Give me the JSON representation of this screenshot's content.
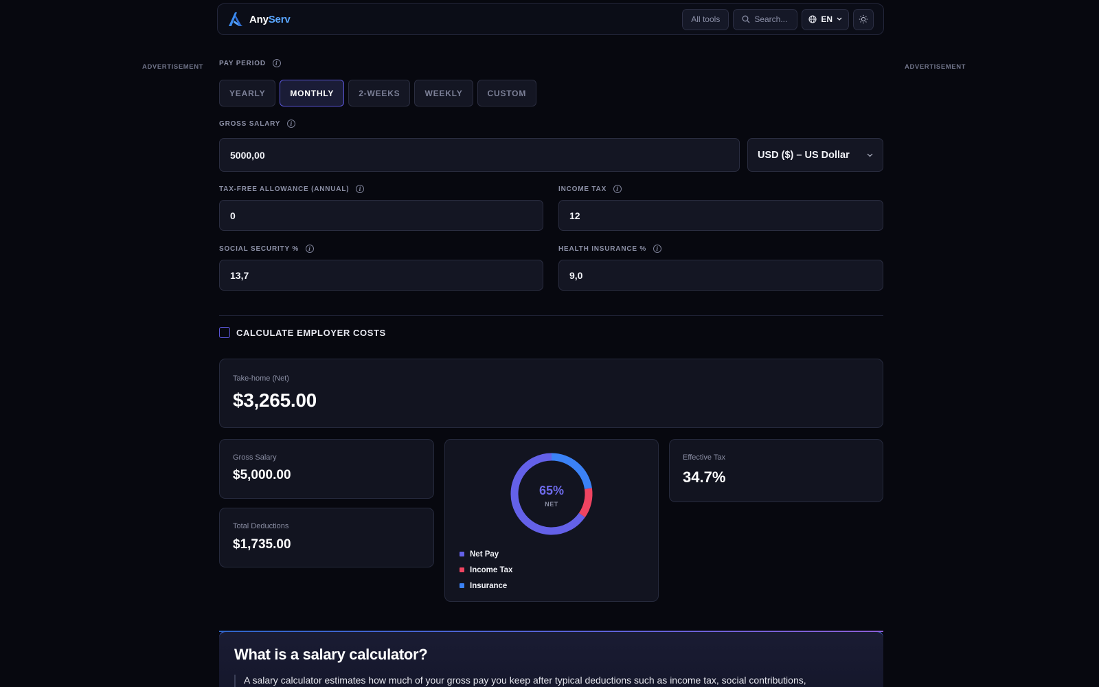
{
  "header": {
    "brand_any": "Any",
    "brand_serv": "Serv",
    "all_tools": "All tools",
    "search_placeholder": "Search...",
    "language": "EN"
  },
  "ads": {
    "left": "ADVERTISEMENT",
    "right": "ADVERTISEMENT"
  },
  "form": {
    "pay_period_label": "PAY PERIOD",
    "pay_periods": [
      "YEARLY",
      "MONTHLY",
      "2-WEEKS",
      "WEEKLY",
      "CUSTOM"
    ],
    "active_period": "MONTHLY",
    "gross_salary_label": "GROSS SALARY",
    "gross_salary_value": "5000,00",
    "currency": "USD ($) – US Dollar",
    "tax_free_label": "TAX-FREE ALLOWANCE (ANNUAL)",
    "tax_free_value": "0",
    "income_tax_label": "INCOME TAX",
    "income_tax_value": "12",
    "social_security_label": "SOCIAL SECURITY %",
    "social_security_value": "13,7",
    "health_insurance_label": "HEALTH INSURANCE %",
    "health_insurance_value": "9,0",
    "employer_costs_label": "CALCULATE EMPLOYER COSTS"
  },
  "results": {
    "net_label": "Take-home (Net)",
    "net_value": "$3,265.00",
    "gross_label": "Gross Salary",
    "gross_value": "$5,000.00",
    "deductions_label": "Total Deductions",
    "deductions_value": "$1,735.00",
    "effective_tax_label": "Effective Tax",
    "effective_tax_value": "34.7%",
    "donut_percent": "65%",
    "donut_sub": "NET",
    "legend": [
      {
        "name": "Net Pay",
        "color": "#6461e8"
      },
      {
        "name": "Income Tax",
        "color": "#ef4461"
      },
      {
        "name": "Insurance",
        "color": "#3b82f6"
      }
    ],
    "breakdown": {
      "net": 3265,
      "income_tax": 600,
      "insurance": 1135
    }
  },
  "info": {
    "title": "What is a salary calculator?",
    "text": "A salary calculator estimates how much of your gross pay you keep after typical deductions such as income tax, social contributions,"
  },
  "colors": {
    "accent": "#5a56d6",
    "brand_blue": "#5aa6ff",
    "background": "#07080f"
  }
}
